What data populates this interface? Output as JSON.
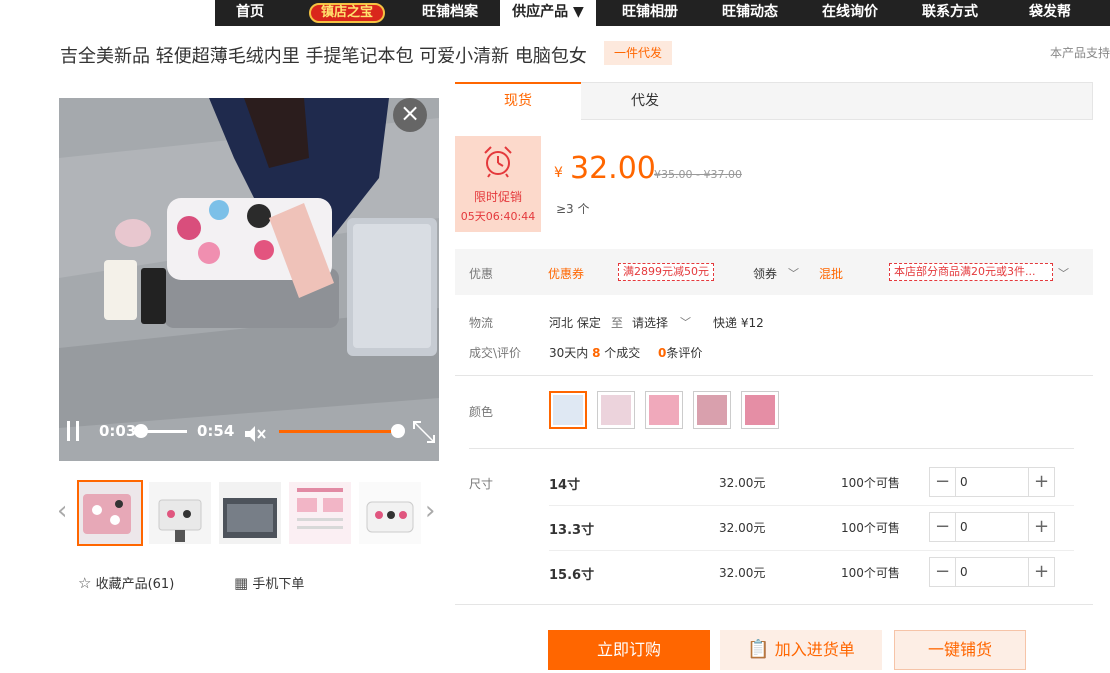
{
  "nav": {
    "items": [
      {
        "label": "首页"
      },
      {
        "label": "镇店之宝"
      },
      {
        "label": "旺铺档案"
      },
      {
        "label": "供应产品 ▼"
      },
      {
        "label": "旺铺相册"
      },
      {
        "label": "旺铺动态"
      },
      {
        "label": "在线询价"
      },
      {
        "label": "联系方式"
      },
      {
        "label": "袋发帮"
      }
    ]
  },
  "product": {
    "title": "吉全美新品 轻便超薄毛绒内里 手提笔记本包 可爱小清新 电脑包女",
    "tag": "一件代发",
    "support_text": "本产品支持"
  },
  "video": {
    "current_time": "0:03",
    "duration": "0:54",
    "progress": 0.06,
    "volume": 0.9
  },
  "thumbnails": [
    {
      "name": "pink-bag-photo",
      "color": "#e7b7c0"
    },
    {
      "name": "bag-spec-photo",
      "color": "#f2f2f2"
    },
    {
      "name": "bag-detail-photo",
      "color": "#555b63"
    },
    {
      "name": "size-chart-photo",
      "color": "#f7e9ee"
    },
    {
      "name": "bag-pattern-photo",
      "color": "#f4f4f4"
    }
  ],
  "actions": {
    "collect": "收藏产品(61)",
    "mobile": "手机下单"
  },
  "tabs": [
    {
      "label": "现货",
      "active": true
    },
    {
      "label": "代发",
      "active": false
    }
  ],
  "promo": {
    "label": "限时促销",
    "countdown": "05天06:40:44"
  },
  "price": {
    "currency": "¥",
    "value": "32.00",
    "original": "¥35.00 - ¥37.00",
    "min_order": "≥3 个"
  },
  "coupons": {
    "label": "优惠",
    "coupon_title": "优惠券",
    "coupon_ticket": "满2899元减50元",
    "claim": "领券",
    "mix_title": "混批",
    "mix_ticket": "本店部分商品满20元或3件..."
  },
  "logistics": {
    "label": "物流",
    "from": "河北 保定",
    "to_word": "至",
    "to": "请选择",
    "express": "快递 ¥12"
  },
  "deals": {
    "label": "成交\\评价",
    "prefix": "30天内",
    "count": "8",
    "suffix": "个成交",
    "reviews": "0",
    "reviews_suffix": "条评价"
  },
  "colors": {
    "label": "颜色",
    "swatches": [
      {
        "name": "white-cats",
        "color": "#dfe8f3"
      },
      {
        "name": "pink-pattern",
        "color": "#ecd3dc"
      },
      {
        "name": "pink-solid",
        "color": "#f0a9bb"
      },
      {
        "name": "pink-set",
        "color": "#d9a0ad"
      },
      {
        "name": "pink-hearts",
        "color": "#e58ea5"
      }
    ]
  },
  "sizes": {
    "label": "尺寸",
    "rows": [
      {
        "name": "14寸",
        "price": "32.00元",
        "stock": "100个可售",
        "qty": "0"
      },
      {
        "name": "13.3寸",
        "price": "32.00元",
        "stock": "100个可售",
        "qty": "0"
      },
      {
        "name": "15.6寸",
        "price": "32.00元",
        "stock": "100个可售",
        "qty": "0"
      }
    ]
  },
  "buttons": {
    "order": "立即订购",
    "add_list": "加入进货单",
    "one_key": "一键铺货"
  },
  "accent": "#ff6600"
}
